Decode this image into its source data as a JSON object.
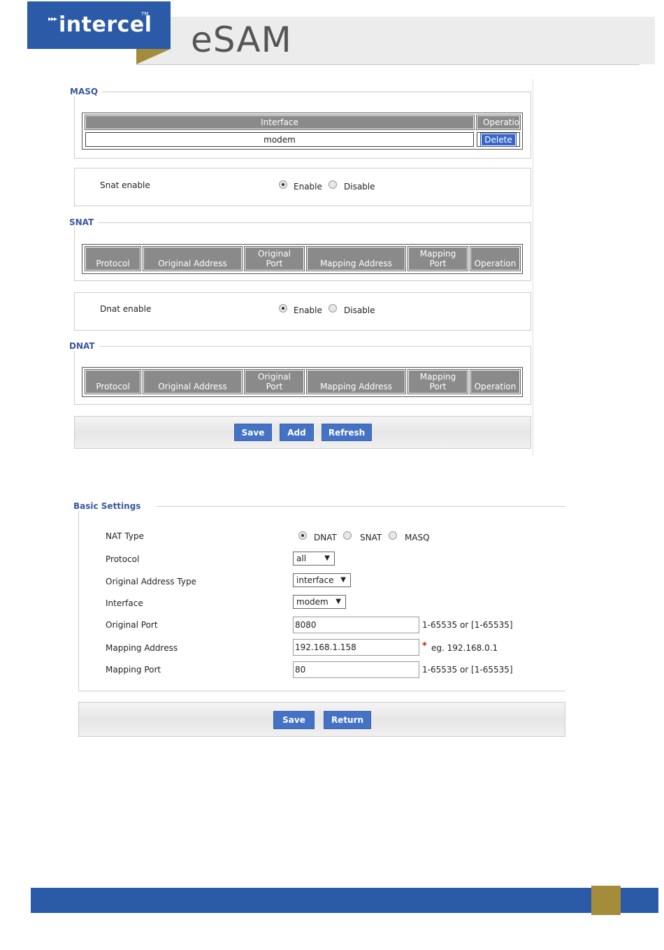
{
  "header": {
    "logo_text": "intercel",
    "logo_arrows": "▸▸▸",
    "logo_tm": "TM",
    "product": "eSAM"
  },
  "masq": {
    "legend": "MASQ",
    "columns": [
      "Interface",
      "Operation"
    ],
    "rows": [
      {
        "interface": "modem",
        "action": "Delete"
      }
    ]
  },
  "snat_enable": {
    "label": "Snat enable",
    "options": [
      "Enable",
      "Disable"
    ],
    "selected": "Enable"
  },
  "snat": {
    "legend": "SNAT",
    "columns": [
      "Protocol",
      "Original Address",
      "Original\nPort",
      "Mapping Address",
      "Mapping\nPort",
      "Operation"
    ]
  },
  "dnat_enable": {
    "label": "Dnat enable",
    "options": [
      "Enable",
      "Disable"
    ],
    "selected": "Enable"
  },
  "dnat": {
    "legend": "DNAT",
    "columns": [
      "Protocol",
      "Original Address",
      "Original\nPort",
      "Mapping Address",
      "Mapping\nPort",
      "Operation"
    ]
  },
  "toolbar1": {
    "save": "Save",
    "add": "Add",
    "refresh": "Refresh"
  },
  "basic": {
    "legend": "Basic Settings",
    "nat_type_label": "NAT Type",
    "nat_type_options": [
      "DNAT",
      "SNAT",
      "MASQ"
    ],
    "nat_type_selected": "DNAT",
    "protocol_label": "Protocol",
    "protocol_value": "all",
    "orig_addr_type_label": "Original Address Type",
    "orig_addr_type_value": "interface",
    "interface_label": "Interface",
    "interface_value": "modem",
    "orig_port_label": "Original Port",
    "orig_port_value": "8080",
    "orig_port_hint": "1-65535 or [1-65535]",
    "map_addr_label": "Mapping Address",
    "map_addr_value": "192.168.1.158",
    "map_addr_required": "*",
    "map_addr_hint": "eg. 192.168.0.1",
    "map_port_label": "Mapping Port",
    "map_port_value": "80",
    "map_port_hint": "1-65535 or [1-65535]"
  },
  "toolbar2": {
    "save": "Save",
    "return": "Return"
  },
  "colors": {
    "brand_blue": "#2b5aa8",
    "brand_gold": "#a58c3a",
    "button_blue": "#4472c4",
    "legend_blue": "#3a57a0",
    "header_gray": "#8a8a8a"
  }
}
